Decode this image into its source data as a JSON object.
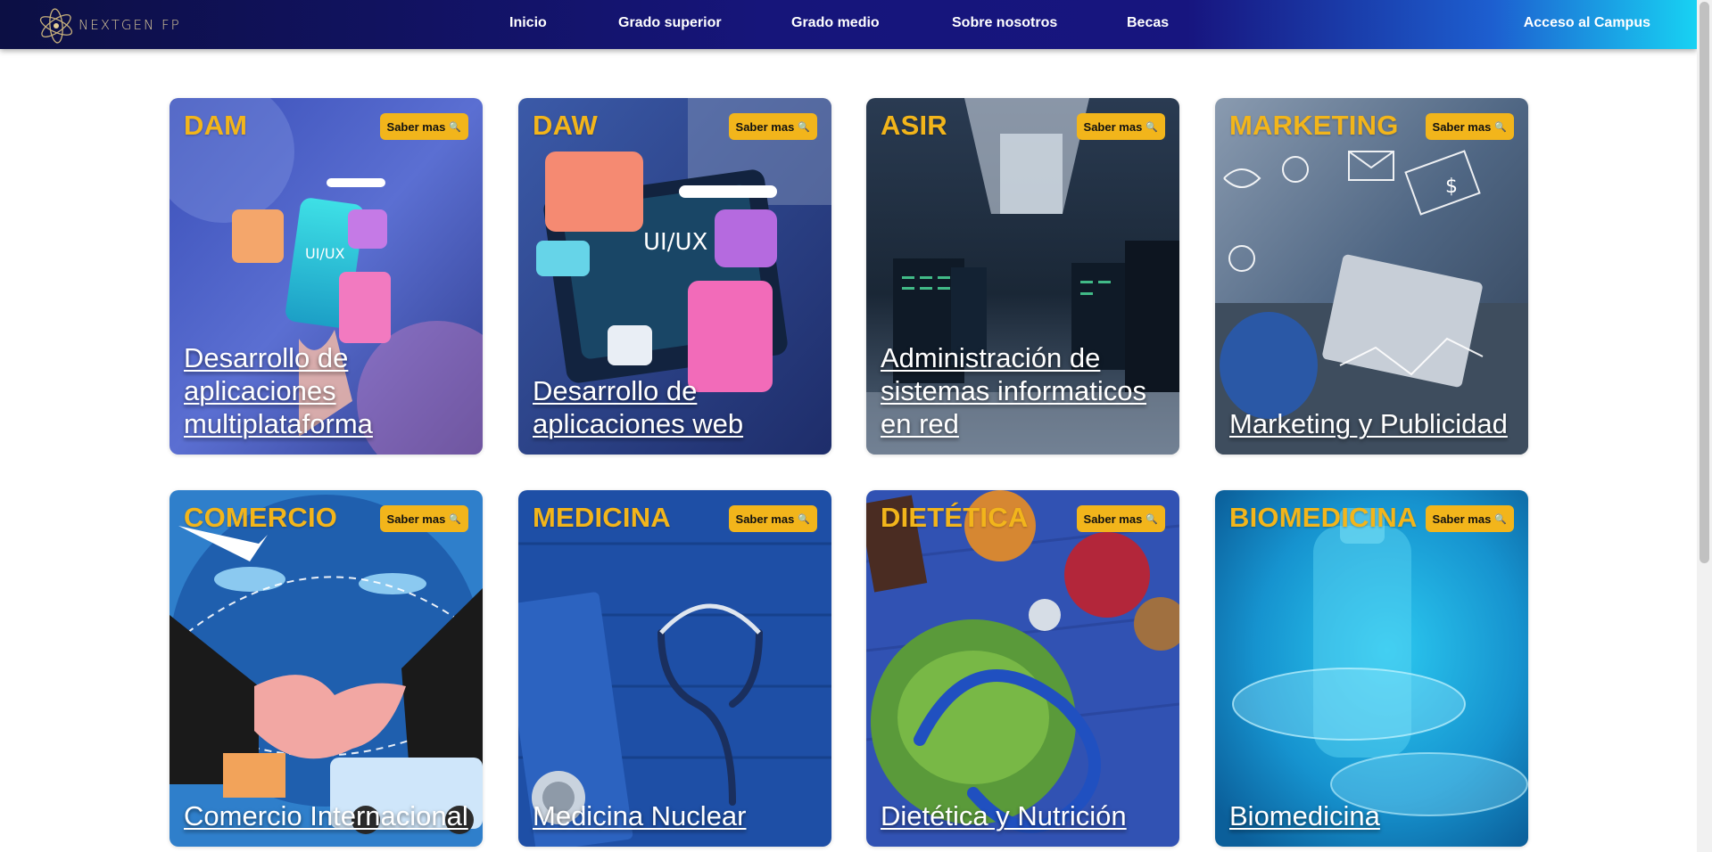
{
  "brand": {
    "name": "NEXTGEN FP",
    "logo_icon": "atom-logo-icon"
  },
  "nav": {
    "links": [
      "Inicio",
      "Grado superior",
      "Grado medio",
      "Sobre nosotros",
      "Becas"
    ],
    "campus": "Acceso al Campus"
  },
  "cards": [
    {
      "code": "DAM",
      "button": "Saber mas",
      "title": "Desarrollo de aplicaciones multiplataforma"
    },
    {
      "code": "DAW",
      "button": "Saber mas",
      "title": "Desarrollo de aplicaciones web"
    },
    {
      "code": "ASIR",
      "button": "Saber mas",
      "title": "Administración de sistemas informaticos en red"
    },
    {
      "code": "MARKETING",
      "button": "Saber mas",
      "title": "Marketing y Publicidad"
    },
    {
      "code": "COMERCIO",
      "button": "Saber mas",
      "title": "Comercio Internacional"
    },
    {
      "code": "MEDICINA",
      "button": "Saber mas",
      "title": "Medicina Nuclear"
    },
    {
      "code": "DIETÉTICA",
      "button": "Saber mas",
      "title": "Dietética y Nutrición"
    },
    {
      "code": "BIOMEDICINA",
      "button": "Saber mas",
      "title": "Biomedicina"
    }
  ],
  "art_text": {
    "uiux": "UI/UX"
  },
  "colors": {
    "accent": "#f2b51b",
    "header_dark": "#0c0f44",
    "header_light": "#18d2f3"
  }
}
